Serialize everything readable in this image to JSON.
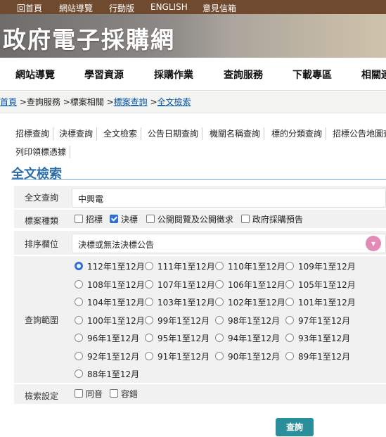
{
  "topbar": {
    "links": [
      "回首頁",
      "網站導覽",
      "行動版",
      "ENGLISH",
      "意見信箱"
    ]
  },
  "banner": {
    "title": "政府電子採購網"
  },
  "mainnav": {
    "items": [
      "網站導覽",
      "學習資源",
      "採購作業",
      "查詢服務",
      "下載專區",
      "相關連"
    ]
  },
  "breadcrumb": {
    "home": "首頁",
    "sep1": " >查詢服務 >標案相關 >",
    "search": "標案查詢",
    "sep2": " >",
    "current": "全文檢索"
  },
  "tabs": [
    "招標查詢",
    "決標查詢",
    "全文檢索",
    "公告日期查詢",
    "機關名稱查詢",
    "標的分類查詢",
    "招標公告地圖查",
    "列印領標憑據"
  ],
  "form": {
    "heading": "全文檢索",
    "query_label": "全文查詢",
    "query_value": "中興電",
    "type_label": "標案種類",
    "types": [
      {
        "label": "招標",
        "checked": false
      },
      {
        "label": "決標",
        "checked": true
      },
      {
        "label": "公開閱覽及公開徵求",
        "checked": false
      },
      {
        "label": "政府採購預告",
        "checked": false
      }
    ],
    "sort_label": "排序欄位",
    "sort_value": "決標或無法決標公告",
    "range_label": "查詢範圍",
    "ranges": [
      "112年1至12月",
      "111年1至12月",
      "110年1至12月",
      "109年1至12月",
      "108年1至12月",
      "107年1至12月",
      "106年1至12月",
      "105年1至12月",
      "104年1至12月",
      "103年1至12月",
      "102年1至12月",
      "101年1至12月",
      "100年1至12月",
      "99年1至12月",
      "98年1至12月",
      "97年1至12月",
      "96年1至12月",
      "95年1至12月",
      "94年1至12月",
      "93年1至12月",
      "92年1至12月",
      "91年1至12月",
      "90年1至12月",
      "89年1至12月",
      "88年1至12月"
    ],
    "range_selected": "112年1至12月",
    "setting_label": "檢索設定",
    "settings": [
      {
        "label": "同音",
        "checked": false
      },
      {
        "label": "容錯",
        "checked": false
      }
    ],
    "submit_label": "查詢"
  },
  "colors": {
    "topbar": "#6f4a2f",
    "accent": "#2f6fd8",
    "submit": "#2a8f9a",
    "heading": "#2b6ea8"
  }
}
